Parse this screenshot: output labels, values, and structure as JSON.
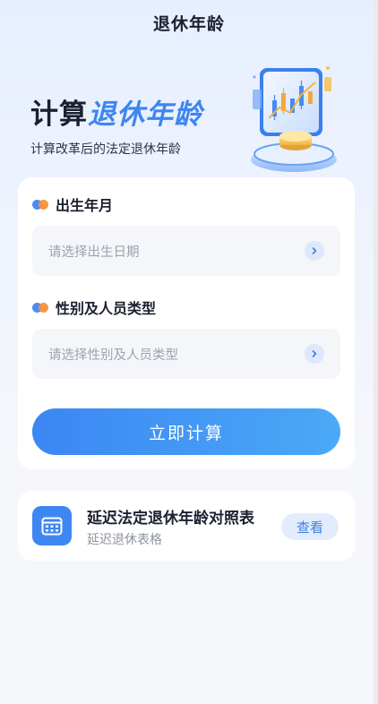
{
  "nav": {
    "title": "退休年龄"
  },
  "hero": {
    "title_part1": "计算",
    "title_part2": "退休年龄",
    "subtitle": "计算改革后的法定退休年龄"
  },
  "form": {
    "birth": {
      "label": "出生年月",
      "placeholder": "请选择出生日期"
    },
    "type": {
      "label": "性别及人员类型",
      "placeholder": "请选择性别及人员类型"
    },
    "submit_label": "立即计算"
  },
  "table_card": {
    "title": "延迟法定退休年龄对照表",
    "subtitle": "延迟退休表格",
    "action_label": "查看"
  },
  "colors": {
    "accent": "#3d86f0",
    "dot_blue": "#4c8cf6",
    "dot_orange": "#f7913a",
    "placeholder": "#9da3ae"
  },
  "icons": [
    "chevron-right-icon",
    "calendar-icon",
    "chart-illustration"
  ]
}
